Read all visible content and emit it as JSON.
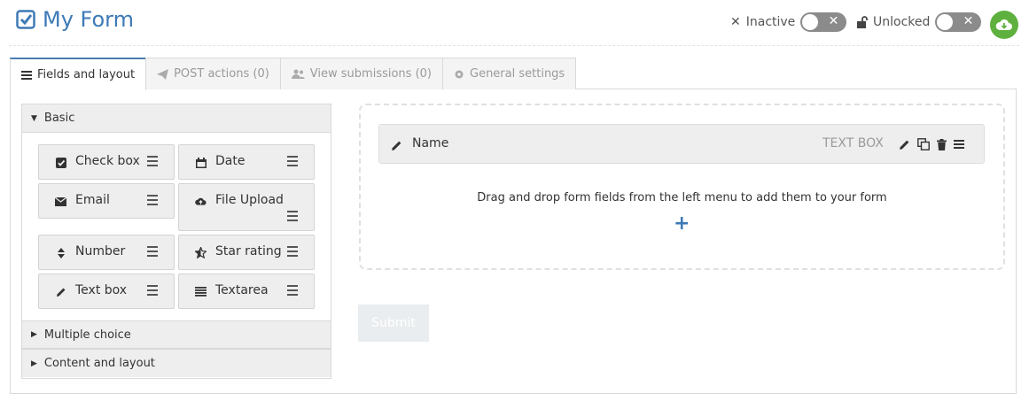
{
  "header": {
    "title": "My Form",
    "status_active_label": "Inactive",
    "status_lock_label": "Unlocked"
  },
  "tabs": [
    {
      "label": "Fields and layout",
      "icon": "list-icon",
      "active": true
    },
    {
      "label": "POST actions (0)",
      "icon": "paper-plane-icon",
      "active": false
    },
    {
      "label": "View submissions (0)",
      "icon": "users-icon",
      "active": false
    },
    {
      "label": "General settings",
      "icon": "gear-icon",
      "active": false
    }
  ],
  "sidebar": {
    "sections": [
      {
        "label": "Basic",
        "expanded": true
      },
      {
        "label": "Multiple choice",
        "expanded": false
      },
      {
        "label": "Content and layout",
        "expanded": false
      }
    ],
    "fields": [
      {
        "label": "Check box",
        "icon": "checkbox-icon"
      },
      {
        "label": "Date",
        "icon": "calendar-icon"
      },
      {
        "label": "Email",
        "icon": "envelope-icon"
      },
      {
        "label": "File Upload",
        "icon": "cloud-upload-icon"
      },
      {
        "label": "Number",
        "icon": "sort-icon"
      },
      {
        "label": "Star rating",
        "icon": "star-half-icon"
      },
      {
        "label": "Text box",
        "icon": "pencil-icon"
      },
      {
        "label": "Textarea",
        "icon": "align-justify-icon"
      }
    ]
  },
  "form": {
    "fields": [
      {
        "name": "Name",
        "type": "TEXT BOX"
      }
    ],
    "drop_message": "Drag and drop form fields from the left menu to add them to your form",
    "add_symbol": "+",
    "submit_label": "Submit"
  },
  "colors": {
    "accent": "#3d7ab6",
    "success": "#5fb13f",
    "toggle_off": "#8b8b8b"
  }
}
